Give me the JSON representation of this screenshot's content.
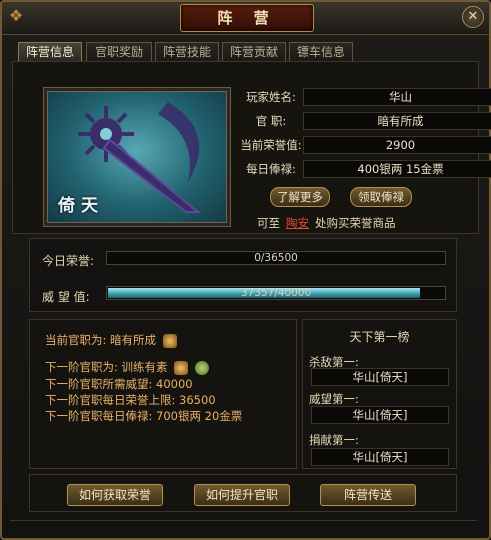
{
  "window": {
    "title": "阵 营"
  },
  "tabs": [
    {
      "label": "阵营信息",
      "active": true
    },
    {
      "label": "官职奖励",
      "active": false
    },
    {
      "label": "阵营技能",
      "active": false
    },
    {
      "label": "阵营贡献",
      "active": false
    },
    {
      "label": "镖车信息",
      "active": false
    }
  ],
  "portrait": {
    "name": "倚天"
  },
  "info": {
    "player_name_label": "玩家姓名:",
    "player_name": "华山",
    "rank_label": "官 职:",
    "rank": "暗有所成",
    "honor_label": "当前荣誉值:",
    "honor": "2900",
    "salary_label": "每日俸禄:",
    "salary": "400银两 15金票"
  },
  "buttons": {
    "learn_more": "了解更多",
    "claim_salary": "领取俸禄",
    "how_get_honor": "如何获取荣誉",
    "how_promote": "如何提升官职",
    "camp_teleport": "阵营传送"
  },
  "shop": {
    "prefix": "可至",
    "link": "陶安",
    "suffix": "处购买荣誉商品"
  },
  "bars": {
    "today_honor_label": "今日荣誉:",
    "today_honor_text": "0/36500",
    "today_honor_value": 0,
    "today_honor_max": 36500,
    "prestige_label": "威 望 值:",
    "prestige_text": "37357/40000",
    "prestige_fraction": 0.93
  },
  "career": {
    "current_label": "当前官职为:",
    "current": "暗有所成",
    "next_label": "下一阶官职为:",
    "next": "训练有素",
    "req_prestige": "下一阶官职所需威望: 40000",
    "honor_cap": "下一阶官职每日荣誉上限: 36500",
    "next_salary": "下一阶官职每日俸禄: 700银两 20金票"
  },
  "ranking": {
    "title": "天下第一榜",
    "kill_label": "杀敌第一:",
    "kill": "华山[倚天]",
    "prestige_label": "威望第一:",
    "prestige": "华山[倚天]",
    "donate_label": "捐献第一:",
    "donate": "华山[倚天]"
  },
  "colors": {
    "accent": "#b5924c",
    "link": "#e24b2c",
    "career_text": "#e9b26a",
    "prestige_bar": "#3b9aaa"
  },
  "icons": {
    "close": "close-icon",
    "rank_badge": "rank-badge-icon",
    "next_badge": "next-rank-badge-icon"
  }
}
